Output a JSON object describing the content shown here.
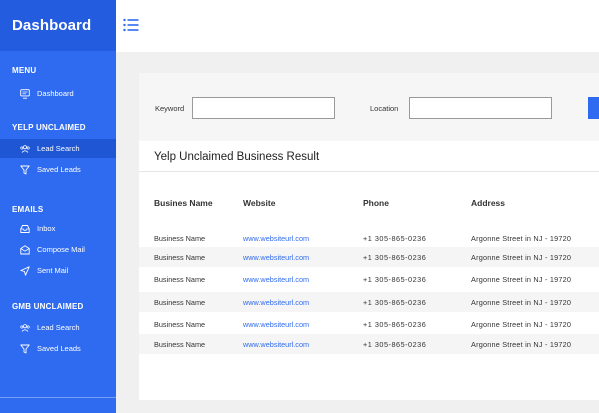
{
  "sidebar": {
    "brand": "Dashboard",
    "sections": [
      {
        "title": "MENU",
        "items": [
          {
            "label": "Dashboard",
            "icon": "monitor-icon",
            "active": false
          }
        ]
      },
      {
        "title": "YELP UNCLAIMED",
        "items": [
          {
            "label": "Lead Search",
            "icon": "users-icon",
            "active": true
          },
          {
            "label": "Saved Leads",
            "icon": "filter-icon",
            "active": false
          }
        ]
      },
      {
        "title": "EMAILS",
        "items": [
          {
            "label": "Inbox",
            "icon": "inbox-icon",
            "active": false
          },
          {
            "label": "Compose Mail",
            "icon": "compose-icon",
            "active": false
          },
          {
            "label": "Sent Mail",
            "icon": "send-icon",
            "active": false
          }
        ]
      },
      {
        "title": "GMB UNCLAIMED",
        "items": [
          {
            "label": "Lead Search",
            "icon": "users-icon",
            "active": false
          },
          {
            "label": "Saved Leads",
            "icon": "filter-icon",
            "active": false
          }
        ]
      }
    ]
  },
  "topbar": {
    "menu_icon": "list-icon"
  },
  "search": {
    "keyword_label": "Keyword",
    "keyword_value": "",
    "location_label": "Location",
    "location_value": ""
  },
  "results": {
    "title": "Yelp Unclaimed Business Result",
    "columns": [
      "Busines Name",
      "Website",
      "Phone",
      "Address"
    ],
    "rows": [
      [
        "Business Name",
        "www.websiteurl.com",
        "+1 305-865-0236",
        "Argonne Street in NJ - 19720"
      ],
      [
        "Business Name",
        "www.websiteurl.com",
        "+1 305-865-0236",
        "Argonne Street in NJ - 19720"
      ],
      [
        "Business Name",
        "www.websiteurl.com",
        "+1 305-865-0236",
        "Argonne Street in NJ - 19720"
      ],
      [
        "Business Name",
        "www.websiteurl.com",
        "+1 305-865-0236",
        "Argonne Street in NJ - 19720"
      ],
      [
        "Business Name",
        "www.websiteurl.com",
        "+1 305-865-0236",
        "Argonne Street in NJ - 19720"
      ],
      [
        "Business Name",
        "www.websiteurl.com",
        "+1 305-865-0236",
        "Argonne Street in NJ - 19720"
      ]
    ]
  },
  "colors": {
    "sidebar": "#2f6bf0",
    "brand_bar": "#245ce0",
    "active_item": "#1f56d4",
    "link": "#2f6bf0"
  }
}
